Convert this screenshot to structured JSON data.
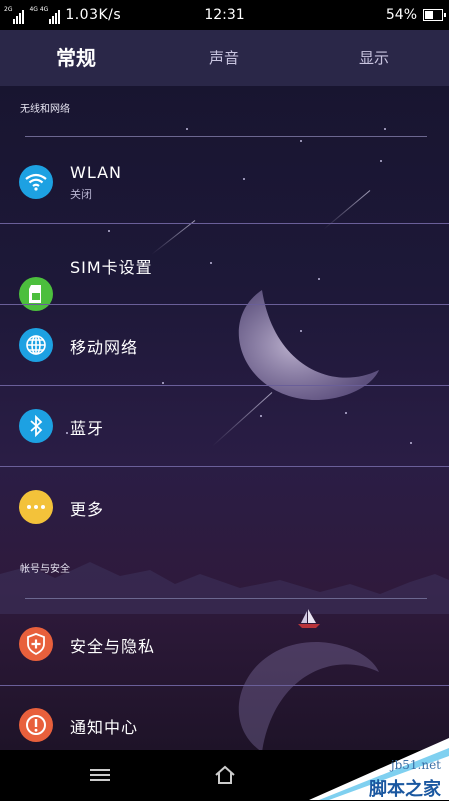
{
  "status_bar": {
    "net_left": "2G",
    "net_right": "4G 4G",
    "speed": "1.03K/s",
    "time": "12:31",
    "battery_percent": "54%",
    "battery_level": 0.54
  },
  "tabs": [
    {
      "label": "常规",
      "active": true
    },
    {
      "label": "声音",
      "active": false
    },
    {
      "label": "显示",
      "active": false
    }
  ],
  "sections": [
    {
      "title": "无线和网络"
    },
    {
      "title": "帐号与安全"
    }
  ],
  "items": [
    {
      "label": "WLAN",
      "sub": "关闭",
      "icon": "wifi-icon",
      "color": "#1da1e2"
    },
    {
      "label": "SIM卡设置",
      "icon": "sim-card-icon",
      "color": "#4cbf3d"
    },
    {
      "label": "移动网络",
      "icon": "globe-icon",
      "color": "#1da1e2"
    },
    {
      "label": "蓝牙",
      "icon": "bluetooth-icon",
      "color": "#1da1e2"
    },
    {
      "label": "更多",
      "icon": "more-dots-icon",
      "color": "#f3c23a"
    },
    {
      "label": "安全与隐私",
      "icon": "shield-plus-icon",
      "color": "#e8603c"
    },
    {
      "label": "通知中心",
      "icon": "alert-icon",
      "color": "#e8603c"
    }
  ],
  "navbar": {
    "buttons": [
      "menu-icon",
      "home-icon",
      "back-icon"
    ]
  },
  "watermark": {
    "site": "jb51.net",
    "name": "脚本之家"
  }
}
